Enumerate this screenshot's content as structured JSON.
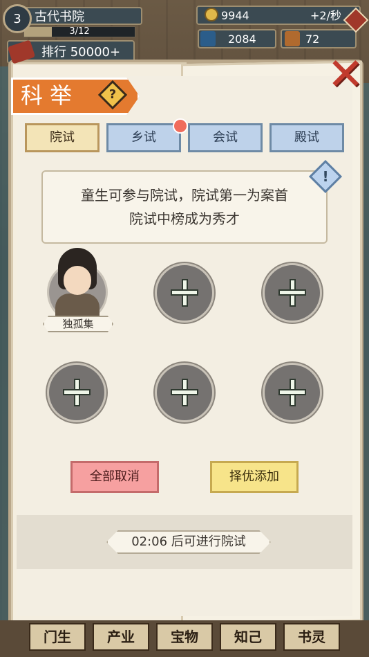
{
  "hud": {
    "level": "3",
    "location": "古代书院",
    "progress_text": "3/12",
    "progress_fraction": 0.25,
    "rank_label": "排行 50000+",
    "coins": "9944",
    "coin_rate": "+2/秒",
    "talent_value": "2084",
    "books_value": "72"
  },
  "modal": {
    "title": "科举",
    "close_label": "✕",
    "tabs": [
      {
        "label": "院试",
        "active": true
      },
      {
        "label": "乡试",
        "active": false,
        "has_badge": true
      },
      {
        "label": "会试",
        "active": false
      },
      {
        "label": "殿试",
        "active": false
      }
    ],
    "info_line1": "童生可参与院试，院试第一为案首",
    "info_line2": "院试中榜成为秀才",
    "candidate_name": "独孤集",
    "cancel_all_label": "全部取消",
    "auto_add_label": "择优添加",
    "timer_text": "02:06 后可进行院试"
  },
  "bottom_nav": {
    "items": [
      "门生",
      "产业",
      "宝物",
      "知己",
      "书灵"
    ]
  }
}
